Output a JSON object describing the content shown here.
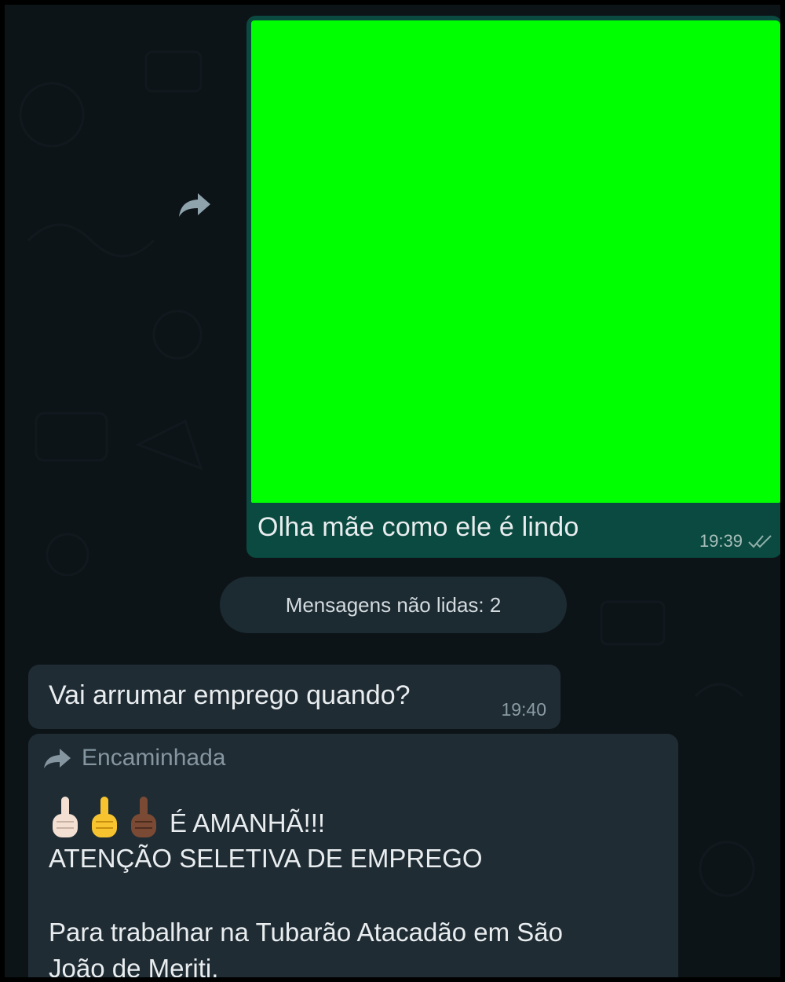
{
  "outgoing_message": {
    "image_color": "#00ff00",
    "caption": "Olha mãe como ele é lindo",
    "time": "19:39",
    "status_icon": "double-check-icon"
  },
  "forward_button_icon": "forward-arrow-icon",
  "unread_divider": {
    "label": "Mensagens não lidas: 2"
  },
  "incoming_messages": [
    {
      "text": "Vai arrumar emprego quando?",
      "time": "19:40"
    },
    {
      "forwarded_label": "Encaminhada",
      "forwarded_icon": "forward-arrow-icon",
      "emojis": [
        "index-pointing-up-light",
        "index-pointing-up-yellow",
        "index-pointing-up-dark"
      ],
      "headline": "É AMANHÃ!!!",
      "line2": "ATENÇÃO SELETIVA DE EMPREGO",
      "line3": "Para trabalhar na Tubarão Atacadão em São",
      "line4": "João de Meriti."
    }
  ],
  "colors": {
    "background": "#0d1418",
    "outgoing_bubble": "#0b4a40",
    "incoming_bubble": "#1f2c34",
    "text": "#e9edef",
    "meta": "#8a9ba3"
  }
}
